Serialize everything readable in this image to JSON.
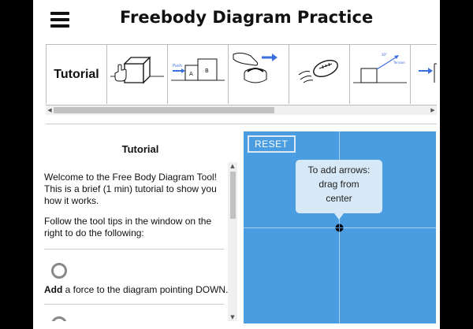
{
  "header": {
    "title": "Freebody Diagram Practice",
    "menu_icon": "hamburger-menu-icon"
  },
  "problems": [
    {
      "label": "Tutorial"
    },
    {
      "icon": "cube-hand-icon"
    },
    {
      "icon": "push-blocks-icon",
      "labels": [
        "Push",
        "A",
        "B"
      ]
    },
    {
      "icon": "hand-push-curling-icon"
    },
    {
      "icon": "football-icon"
    },
    {
      "icon": "ramp-tension-icon",
      "labels": [
        "30°",
        "Tension"
      ]
    },
    {
      "icon": "partial-arrow-icon"
    }
  ],
  "tutorial": {
    "title": "Tutorial",
    "intro": "Welcome to the Free Body Diagram Tool! This is a brief (1 min) tutorial to show you how it works.",
    "instructions": "Follow the tool tips in the window on the right to do the following:",
    "steps": [
      {
        "bold": "Add",
        "text": " a force to the diagram pointing DOWN."
      }
    ]
  },
  "canvas": {
    "reset_label": "RESET",
    "tooltip": [
      "To add arrows:",
      "drag from",
      "center"
    ],
    "background": "#4a9de1",
    "accent": "#3b6fe0"
  }
}
